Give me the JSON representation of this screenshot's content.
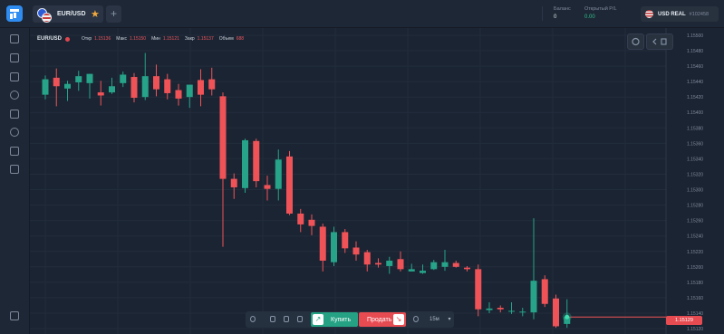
{
  "header": {
    "pair_tab_label": "EUR/USD",
    "add_tab_label": "+",
    "balance_label": "Баланс",
    "balance_value": "0",
    "pl_label": "Открытый P/L",
    "pl_value": "0.00",
    "account_label": "USD REAL",
    "account_id": "#102458"
  },
  "chart_header": {
    "pair": "EUR/USD",
    "open_label": "Откр",
    "open_value": "1.15136",
    "high_label": "Макс",
    "high_value": "1.15150",
    "low_label": "Мин",
    "low_value": "1.15121",
    "close_label": "Закр",
    "close_value": "1.15137",
    "volume_label": "Объем",
    "volume_value": "688"
  },
  "bottom_bar": {
    "buy_label": "Купить",
    "sell_label": "Продать",
    "timeframe": "15м"
  },
  "current_price": "1.15129",
  "colors": {
    "bull": "#26a389",
    "bear": "#ef5358",
    "background": "#1b2432",
    "accent": "#2f8cf0"
  },
  "icons": {
    "sidebar": [
      "chart-icon",
      "portfolio-icon",
      "briefcase-icon",
      "clock-icon",
      "book-icon",
      "settings-icon",
      "news-icon",
      "calendar-icon",
      "logout-icon"
    ],
    "chart_tools": [
      "chart-type-icon",
      "indicators-icon",
      "draw-icon",
      "magnet-icon",
      "timer-icon"
    ]
  },
  "chart_data": {
    "type": "candlestick",
    "y_ticks": [
      "1.15500",
      "1.15480",
      "1.15460",
      "1.15440",
      "1.15420",
      "1.15400",
      "1.15380",
      "1.15360",
      "1.15340",
      "1.15320",
      "1.15300",
      "1.15280",
      "1.15260",
      "1.15240",
      "1.15220",
      "1.15200",
      "1.15180",
      "1.15160",
      "1.15140",
      "1.15120"
    ],
    "ylim": [
      1.15113,
      1.15507
    ],
    "grid": true,
    "candles": [
      {
        "o": 1.15423,
        "h": 1.15448,
        "l": 1.15417,
        "c": 1.15443
      },
      {
        "o": 1.15445,
        "h": 1.15457,
        "l": 1.15408,
        "c": 1.15434
      },
      {
        "o": 1.15431,
        "h": 1.15441,
        "l": 1.15415,
        "c": 1.15437
      },
      {
        "o": 1.15439,
        "h": 1.15454,
        "l": 1.15428,
        "c": 1.15447
      },
      {
        "o": 1.15438,
        "h": 1.1545,
        "l": 1.15418,
        "c": 1.1545
      },
      {
        "o": 1.15426,
        "h": 1.15441,
        "l": 1.15409,
        "c": 1.15422
      },
      {
        "o": 1.15426,
        "h": 1.15445,
        "l": 1.15424,
        "c": 1.15434
      },
      {
        "o": 1.15438,
        "h": 1.15453,
        "l": 1.15433,
        "c": 1.15449
      },
      {
        "o": 1.15446,
        "h": 1.15451,
        "l": 1.15413,
        "c": 1.15419
      },
      {
        "o": 1.1542,
        "h": 1.15477,
        "l": 1.15416,
        "c": 1.15447
      },
      {
        "o": 1.15447,
        "h": 1.15462,
        "l": 1.15421,
        "c": 1.1543
      },
      {
        "o": 1.15443,
        "h": 1.1545,
        "l": 1.15417,
        "c": 1.15425
      },
      {
        "o": 1.15429,
        "h": 1.15437,
        "l": 1.15409,
        "c": 1.15418
      },
      {
        "o": 1.1542,
        "h": 1.15435,
        "l": 1.15406,
        "c": 1.15436
      },
      {
        "o": 1.15442,
        "h": 1.15456,
        "l": 1.15408,
        "c": 1.15423
      },
      {
        "o": 1.15443,
        "h": 1.15458,
        "l": 1.15422,
        "c": 1.1543
      },
      {
        "o": 1.15421,
        "h": 1.15426,
        "l": 1.15226,
        "c": 1.15314
      },
      {
        "o": 1.15314,
        "h": 1.15321,
        "l": 1.15288,
        "c": 1.15303
      },
      {
        "o": 1.15302,
        "h": 1.15366,
        "l": 1.15296,
        "c": 1.15364
      },
      {
        "o": 1.15363,
        "h": 1.15366,
        "l": 1.15303,
        "c": 1.15311
      },
      {
        "o": 1.15306,
        "h": 1.15318,
        "l": 1.15286,
        "c": 1.15301
      },
      {
        "o": 1.15301,
        "h": 1.15352,
        "l": 1.15286,
        "c": 1.15339
      },
      {
        "o": 1.15343,
        "h": 1.1535,
        "l": 1.15267,
        "c": 1.15269
      },
      {
        "o": 1.15269,
        "h": 1.15275,
        "l": 1.15245,
        "c": 1.15255
      },
      {
        "o": 1.15261,
        "h": 1.15268,
        "l": 1.15241,
        "c": 1.15253
      },
      {
        "o": 1.15252,
        "h": 1.15256,
        "l": 1.15194,
        "c": 1.15208
      },
      {
        "o": 1.15206,
        "h": 1.15252,
        "l": 1.15201,
        "c": 1.15245
      },
      {
        "o": 1.15245,
        "h": 1.15249,
        "l": 1.15218,
        "c": 1.15224
      },
      {
        "o": 1.15225,
        "h": 1.15233,
        "l": 1.15208,
        "c": 1.15216
      },
      {
        "o": 1.15219,
        "h": 1.15222,
        "l": 1.15194,
        "c": 1.15203
      },
      {
        "o": 1.15205,
        "h": 1.15211,
        "l": 1.15199,
        "c": 1.15203
      },
      {
        "o": 1.15201,
        "h": 1.15213,
        "l": 1.15191,
        "c": 1.15208
      },
      {
        "o": 1.1521,
        "h": 1.1522,
        "l": 1.15194,
        "c": 1.15197
      },
      {
        "o": 1.15194,
        "h": 1.15204,
        "l": 1.15194,
        "c": 1.15197
      },
      {
        "o": 1.15192,
        "h": 1.15203,
        "l": 1.15191,
        "c": 1.15195
      },
      {
        "o": 1.15197,
        "h": 1.15209,
        "l": 1.15196,
        "c": 1.15206
      },
      {
        "o": 1.152,
        "h": 1.15222,
        "l": 1.15195,
        "c": 1.15206
      },
      {
        "o": 1.15205,
        "h": 1.15208,
        "l": 1.15199,
        "c": 1.152
      },
      {
        "o": 1.15199,
        "h": 1.15201,
        "l": 1.15194,
        "c": 1.15197
      },
      {
        "o": 1.15197,
        "h": 1.15203,
        "l": 1.15136,
        "c": 1.15145
      },
      {
        "o": 1.15144,
        "h": 1.15154,
        "l": 1.1514,
        "c": 1.15146
      },
      {
        "o": 1.15147,
        "h": 1.1515,
        "l": 1.15141,
        "c": 1.15145
      },
      {
        "o": 1.15142,
        "h": 1.15154,
        "l": 1.15139,
        "c": 1.15143
      },
      {
        "o": 1.15141,
        "h": 1.15147,
        "l": 1.15136,
        "c": 1.15142
      },
      {
        "o": 1.15141,
        "h": 1.15263,
        "l": 1.15132,
        "c": 1.15182
      },
      {
        "o": 1.15184,
        "h": 1.15189,
        "l": 1.15148,
        "c": 1.15152
      },
      {
        "o": 1.15159,
        "h": 1.15164,
        "l": 1.15121,
        "c": 1.15123
      },
      {
        "o": 1.15126,
        "h": 1.15158,
        "l": 1.15121,
        "c": 1.15135
      }
    ]
  }
}
